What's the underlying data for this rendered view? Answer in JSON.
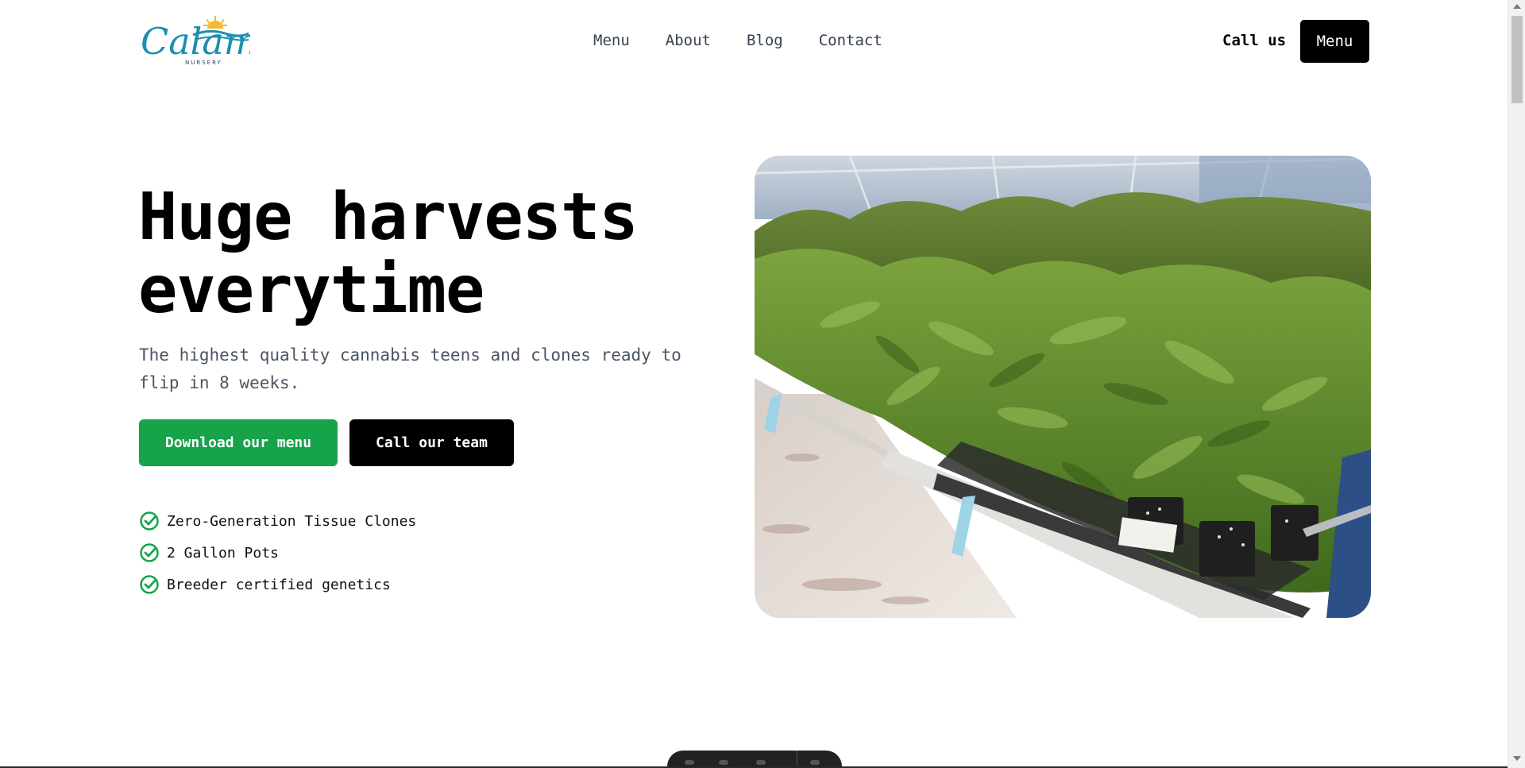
{
  "brand": {
    "logo_text": "Calamus",
    "logo_subtext": "NURSERY",
    "colors": {
      "teal": "#1b8fb0",
      "sun": "#f5b82e",
      "navy": "#1e3a5f"
    }
  },
  "nav": {
    "items": [
      {
        "label": "Menu"
      },
      {
        "label": "About"
      },
      {
        "label": "Blog"
      },
      {
        "label": "Contact"
      }
    ],
    "call_us": "Call us",
    "menu_button": "Menu"
  },
  "hero": {
    "title_line1": "Huge harvests",
    "title_line2": "everytime",
    "subtitle": "The highest quality cannabis teens and clones ready to flip in 8 weeks.",
    "primary_button": "Download our menu",
    "secondary_button": "Call our team",
    "features": [
      {
        "label": "Zero-Generation Tissue Clones",
        "icon": "check-circle-icon"
      },
      {
        "label": "2 Gallon Pots",
        "icon": "check-circle-icon"
      },
      {
        "label": "Breeder certified genetics",
        "icon": "check-circle-icon"
      }
    ],
    "image_icon": "greenhouse-cannabis-plants-photo"
  },
  "colors": {
    "accent_green": "#16a34a",
    "black": "#000000",
    "text_gray": "#4b5563"
  }
}
